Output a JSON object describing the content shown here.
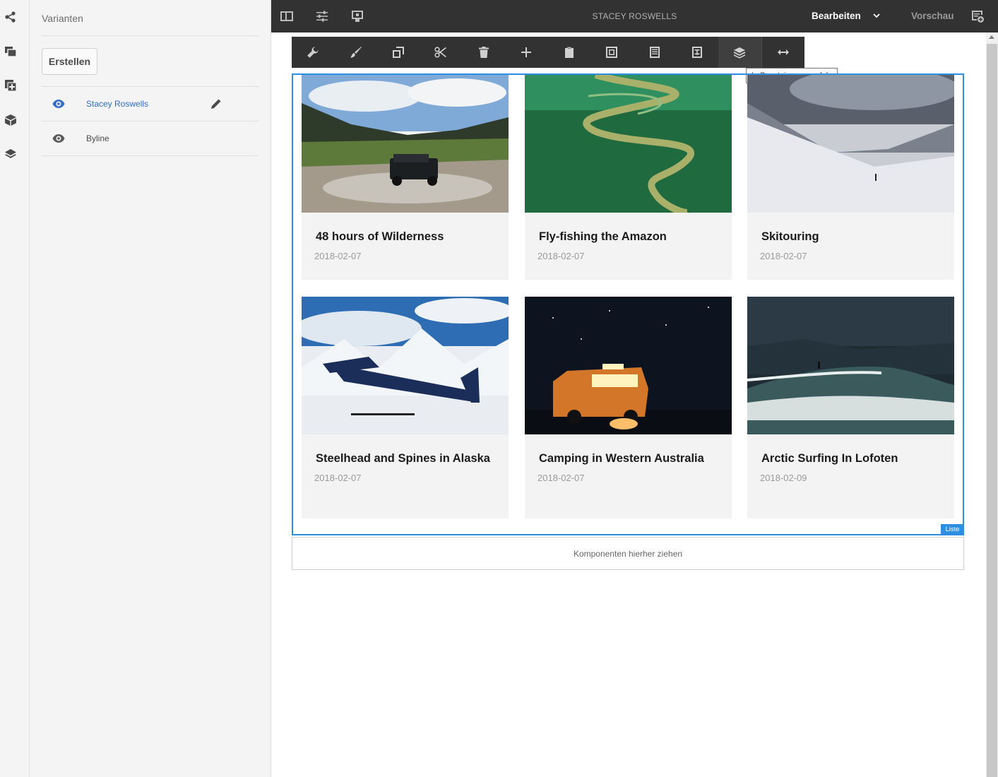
{
  "rail": {
    "icons": [
      "share-graph-icon",
      "assets-icon",
      "add-component-icon",
      "package-icon",
      "layers-icon"
    ]
  },
  "panel": {
    "title": "Varianten",
    "create_label": "Erstellen",
    "variants": [
      {
        "label": "Stacey Roswells",
        "active": true,
        "icon": "eye-icon"
      },
      {
        "label": "Byline",
        "active": false,
        "icon": "eye-icon"
      }
    ]
  },
  "topbar": {
    "title": "STACEY ROSWELLS",
    "mode_label": "Bearbeiten",
    "preview_label": "Vorschau",
    "icons": [
      "side-panel-toggle-icon",
      "properties-icon",
      "emulator-icon",
      "annotations-icon"
    ]
  },
  "component_toolbar": {
    "buttons": [
      "wrench-icon",
      "brush-icon",
      "copy-icon",
      "cut-icon",
      "delete-icon",
      "insert-icon",
      "paste-icon",
      "group-icon",
      "list-icon",
      "template-icon",
      "convert-to-block-icon",
      "layout-icon"
    ],
    "tooltip": "In Baustein umwandeln"
  },
  "list": {
    "tag": "Liste",
    "items": [
      {
        "title": "48 hours of Wilderness",
        "date": "2018-02-07",
        "image": "offroad-river"
      },
      {
        "title": "Fly-fishing the Amazon",
        "date": "2018-02-07",
        "image": "amazon-river"
      },
      {
        "title": "Skitouring",
        "date": "2018-02-07",
        "image": "snow-slope"
      },
      {
        "title": "Steelhead and Spines in Alaska",
        "date": "2018-02-07",
        "image": "seaplane"
      },
      {
        "title": "Camping in Western Australia",
        "date": "2018-02-07",
        "image": "night-van"
      },
      {
        "title": "Arctic Surfing In Lofoten",
        "date": "2018-02-09",
        "image": "surf-wave"
      }
    ]
  },
  "dropzone": {
    "label": "Komponenten hierher ziehen"
  },
  "colors": {
    "accent": "#2d8ee2",
    "toolbar": "#323232",
    "active_variant": "#326ec8"
  }
}
